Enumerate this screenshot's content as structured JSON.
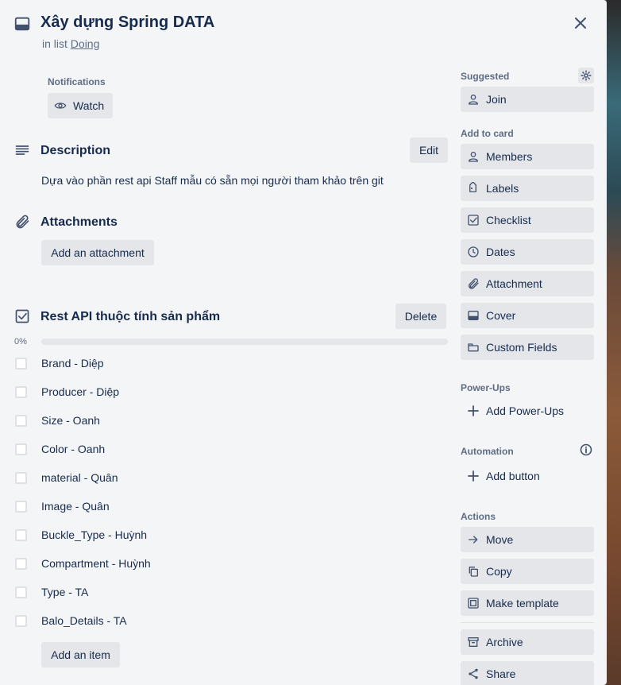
{
  "card": {
    "title": "Xây dựng Spring DATA",
    "in_list_prefix": "in list",
    "list_name": "Doing"
  },
  "notifications": {
    "label": "Notifications",
    "watch_label": "Watch"
  },
  "description": {
    "title": "Description",
    "edit_label": "Edit",
    "text": "Dựa vào phần rest api Staff mẫu có sẵn mọi người tham khảo trên git"
  },
  "attachments": {
    "title": "Attachments",
    "add_label": "Add an attachment"
  },
  "checklist": {
    "title": "Rest API thuộc tính sản phẩm",
    "delete_label": "Delete",
    "progress_text": "0%",
    "progress_fraction": 0,
    "items": [
      {
        "label": "Brand - Diệp",
        "checked": false
      },
      {
        "label": "Producer - Diệp",
        "checked": false
      },
      {
        "label": "Size - Oanh",
        "checked": false
      },
      {
        "label": "Color - Oanh",
        "checked": false
      },
      {
        "label": "material - Quân",
        "checked": false
      },
      {
        "label": "Image - Quân",
        "checked": false
      },
      {
        "label": "Buckle_Type - Huỳnh",
        "checked": false
      },
      {
        "label": "Compartment - Huỳnh",
        "checked": false
      },
      {
        "label": "Type - TA",
        "checked": false
      },
      {
        "label": "Balo_Details - TA",
        "checked": false
      }
    ],
    "add_item_label": "Add an item"
  },
  "sidebar": {
    "suggested_label": "Suggested",
    "join_label": "Join",
    "add_to_card_label": "Add to card",
    "add_to_card": [
      {
        "label": "Members",
        "icon": "person-icon"
      },
      {
        "label": "Labels",
        "icon": "tag-icon"
      },
      {
        "label": "Checklist",
        "icon": "checklist-icon"
      },
      {
        "label": "Dates",
        "icon": "clock-icon"
      },
      {
        "label": "Attachment",
        "icon": "paperclip-icon"
      },
      {
        "label": "Cover",
        "icon": "cover-icon"
      },
      {
        "label": "Custom Fields",
        "icon": "custom-fields-icon"
      }
    ],
    "powerups_label": "Power-Ups",
    "add_powerups_label": "Add Power-Ups",
    "automation_label": "Automation",
    "add_button_label": "Add button",
    "actions_label": "Actions",
    "actions": [
      {
        "label": "Move",
        "icon": "arrow-right-icon"
      },
      {
        "label": "Copy",
        "icon": "copy-icon"
      },
      {
        "label": "Make template",
        "icon": "template-icon"
      },
      {
        "label": "Archive",
        "icon": "archive-icon"
      },
      {
        "label": "Share",
        "icon": "share-icon"
      }
    ]
  },
  "colors": {
    "text": "#172b4d",
    "muted": "#5e6c84",
    "button_bg": "#e4e6ea",
    "modal_bg": "#f4f5f7",
    "progress_fill": "#5aac44"
  }
}
